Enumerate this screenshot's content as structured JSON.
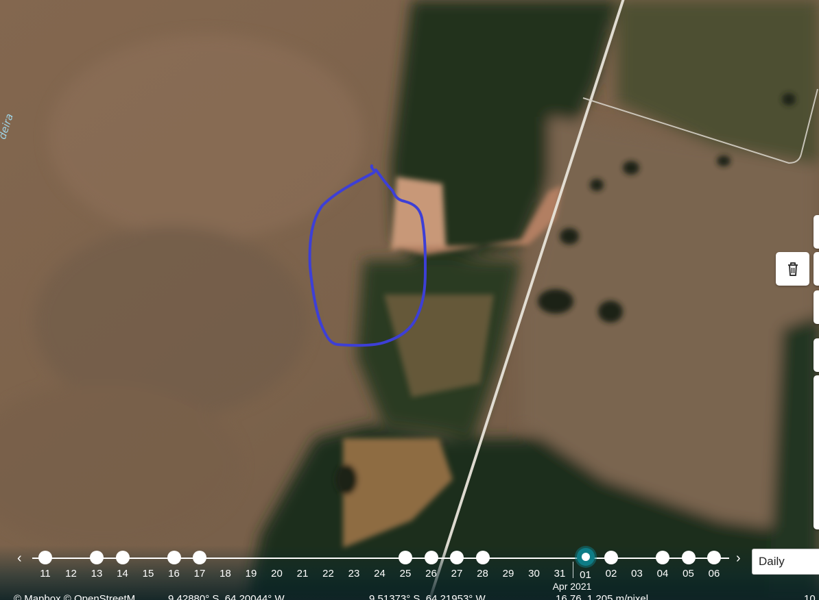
{
  "map": {
    "road_label": "deira",
    "imagery": "satellite"
  },
  "toolbar": {
    "delete_icon": "trash-icon"
  },
  "timeline": {
    "prev_icon": "chevron-left-icon",
    "next_icon": "chevron-right-icon",
    "days": [
      {
        "label": "11",
        "has_image": true
      },
      {
        "label": "12",
        "has_image": false
      },
      {
        "label": "13",
        "has_image": true
      },
      {
        "label": "14",
        "has_image": true
      },
      {
        "label": "15",
        "has_image": false
      },
      {
        "label": "16",
        "has_image": true
      },
      {
        "label": "17",
        "has_image": true
      },
      {
        "label": "18",
        "has_image": false
      },
      {
        "label": "19",
        "has_image": false
      },
      {
        "label": "20",
        "has_image": false
      },
      {
        "label": "21",
        "has_image": false
      },
      {
        "label": "22",
        "has_image": false
      },
      {
        "label": "23",
        "has_image": false
      },
      {
        "label": "24",
        "has_image": false
      },
      {
        "label": "25",
        "has_image": true
      },
      {
        "label": "26",
        "has_image": true
      },
      {
        "label": "27",
        "has_image": true
      },
      {
        "label": "28",
        "has_image": true
      },
      {
        "label": "29",
        "has_image": false
      },
      {
        "label": "30",
        "has_image": false
      },
      {
        "label": "31",
        "has_image": false
      },
      {
        "label": "01",
        "has_image": true,
        "selected": true
      },
      {
        "label": "02",
        "has_image": true
      },
      {
        "label": "03",
        "has_image": false
      },
      {
        "label": "04",
        "has_image": true
      },
      {
        "label": "05",
        "has_image": true
      },
      {
        "label": "06",
        "has_image": true
      }
    ],
    "month_label": "Apr 2021",
    "interval_select": "Daily"
  },
  "status_bar": {
    "attribution": "© Mapbox © OpenStreetM",
    "center_coords": "9.42880° S, 64.20044° W",
    "cursor_coords": "9.51373° S, 64.21953° W",
    "zoom_scale": "16.76, 1.205 m/pixel",
    "extra": "10"
  },
  "colors": {
    "selected_accent": "#0e7c86",
    "drawn_outline": "#3d3fd6"
  }
}
